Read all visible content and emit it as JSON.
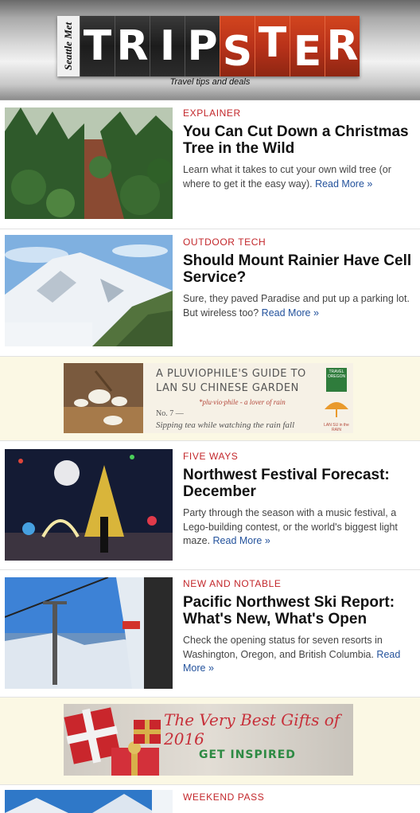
{
  "header": {
    "brand": "Seattle Met",
    "title_letters": [
      "T",
      "R",
      "I",
      "P",
      "S",
      "T",
      "E",
      "R"
    ],
    "tagline": "Travel tips and deals"
  },
  "stories": [
    {
      "kicker": "EXPLAINER",
      "headline": "You Can Cut Down a Christmas Tree in the Wild",
      "dek": "Learn what it takes to cut your own wild tree (or where to get it the easy way).",
      "more": "Read More »"
    },
    {
      "kicker": "OUTDOOR TECH",
      "headline": "Should Mount Rainier Have Cell Service?",
      "dek": "Sure, they paved Paradise and put up a parking lot. But wireless too?",
      "more": "Read More »"
    },
    {
      "kicker": "FIVE WAYS",
      "headline": "Northwest Festival Forecast: December",
      "dek": "Party through the season with a music festival, a Lego-building contest, or the world's biggest light maze.",
      "more": "Read More »"
    },
    {
      "kicker": "NEW AND NOTABLE",
      "headline": "Pacific Northwest Ski Report: What's New, What's Open",
      "dek": "Check the opening status for seven resorts in Washington, Oregon, and British Columbia.",
      "more": "Read More »"
    },
    {
      "kicker": "WEEKEND PASS",
      "headline": "",
      "dek": "",
      "more": ""
    }
  ],
  "ad1": {
    "line1": "A PLUVIOPHILE'S",
    "line2": "GUIDE TO",
    "line3": "LAN SU CHINESE GARDEN",
    "definition": "*plu·vio·phile - a lover of rain",
    "number": "No. 7 —",
    "caption": "Sipping tea while watching the rain fall",
    "badge_top": "TRAVEL OREGON",
    "badge_bottom": "LAN SU in the RAIN"
  },
  "ad2": {
    "title_script": "The Very Best Gifts of 2016",
    "cta": "GET INSPIRED"
  }
}
